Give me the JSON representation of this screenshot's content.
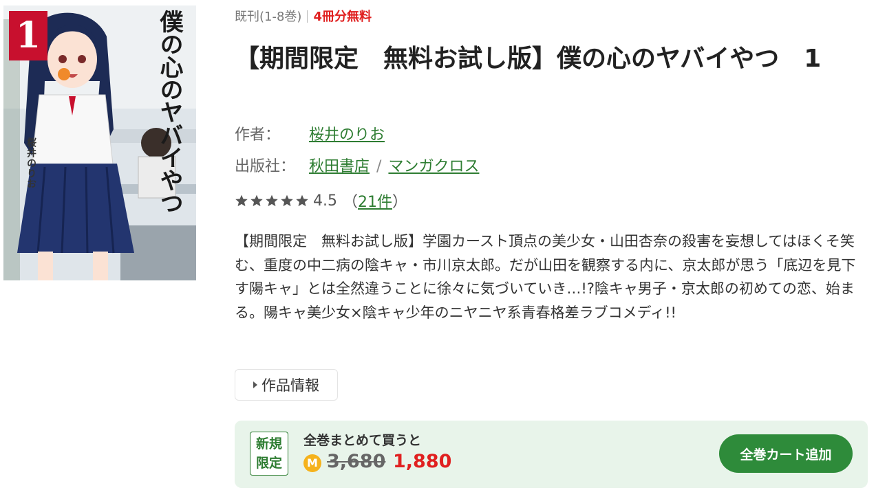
{
  "cover": {
    "volume_number": "1",
    "title_text": "僕の心のヤバイやつ",
    "author_text": "桜井のりお"
  },
  "status": {
    "published": "既刊(1-8巻)",
    "free_note": "4冊分無料"
  },
  "title": "【期間限定　無料お試し版】僕の心のヤバイやつ　1",
  "author": {
    "label": "作者：",
    "name": "桜井のりお"
  },
  "publisher": {
    "label": "出版社：",
    "name": "秋田書店",
    "separator": "/",
    "label_name": "マンガクロス"
  },
  "rating": {
    "stars": 5,
    "value": "4.5",
    "open": "（",
    "count": "21件",
    "close": "）"
  },
  "description": "【期間限定　無料お試し版】学園カースト頂点の美少女・山田杏奈の殺害を妄想してはほくそ笑む、重度の中二病の陰キャ・市川京太郎。だが山田を観察する内に、京太郎が思う「底辺を見下す陽キャ」とは全然違うことに徐々に気づいていき…!?陰キャ男子・京太郎の初めての恋、始まる。陽キャ美少女×陰キャ少年のニヤニヤ系青春格差ラブコメディ!!",
  "info_toggle": "作品情報",
  "bundle": {
    "badge_line1": "新規",
    "badge_line2": "限定",
    "label": "全巻まとめて買うと",
    "coin": "M",
    "old_price": "3,680",
    "new_price": "1,880",
    "cart_button": "全巻カート追加"
  },
  "colors": {
    "accent_green": "#2e8b3a",
    "sale_red": "#e02020",
    "coin_gold": "#f5b21c"
  }
}
